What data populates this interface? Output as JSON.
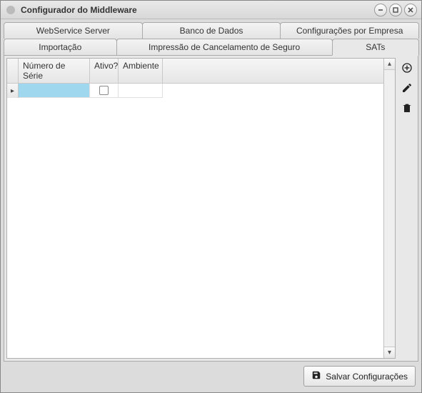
{
  "window": {
    "title": "Configurador do Middleware"
  },
  "tabs_row1": {
    "webservice": "WebService Server",
    "banco": "Banco de Dados",
    "config_empresa": "Configurações por Empresa"
  },
  "tabs_row2": {
    "importacao": "Importação",
    "impressao_cancel": "Impressão de Cancelamento de Seguro",
    "sats": "SATs"
  },
  "grid": {
    "columns": {
      "numero_serie": "Número de Série",
      "ativo": "Ativo?",
      "ambiente": "Ambiente"
    },
    "rows": [
      {
        "numero_serie": "",
        "ativo": false,
        "ambiente": ""
      }
    ]
  },
  "footer": {
    "save_label": "Salvar Configurações"
  }
}
